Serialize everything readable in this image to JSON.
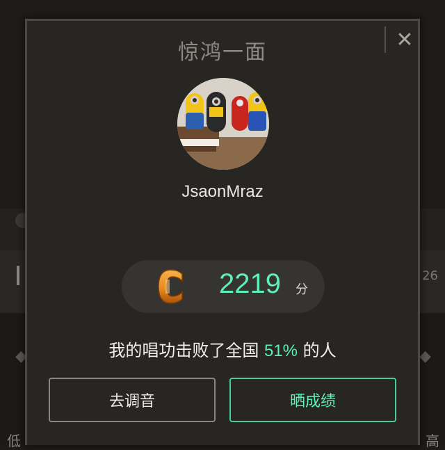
{
  "background": {
    "right_number": "26",
    "low_label": "低",
    "high_label": "高"
  },
  "dialog": {
    "title": "惊鸿一面",
    "close_symbol": "✕",
    "username": "JsaonMraz",
    "grade": "C",
    "score": "2219",
    "score_unit": "分",
    "result": {
      "prefix": "我的唱功击败了全国 ",
      "percent": "51%",
      "suffix": " 的人"
    },
    "buttons": {
      "tune_label": "去调音",
      "share_label": "晒成绩"
    }
  },
  "colors": {
    "accent": "#5ef0b6",
    "grade_orange": "#e98b1f"
  },
  "icons": {
    "close": "close-icon",
    "grade": "grade-c-badge"
  }
}
